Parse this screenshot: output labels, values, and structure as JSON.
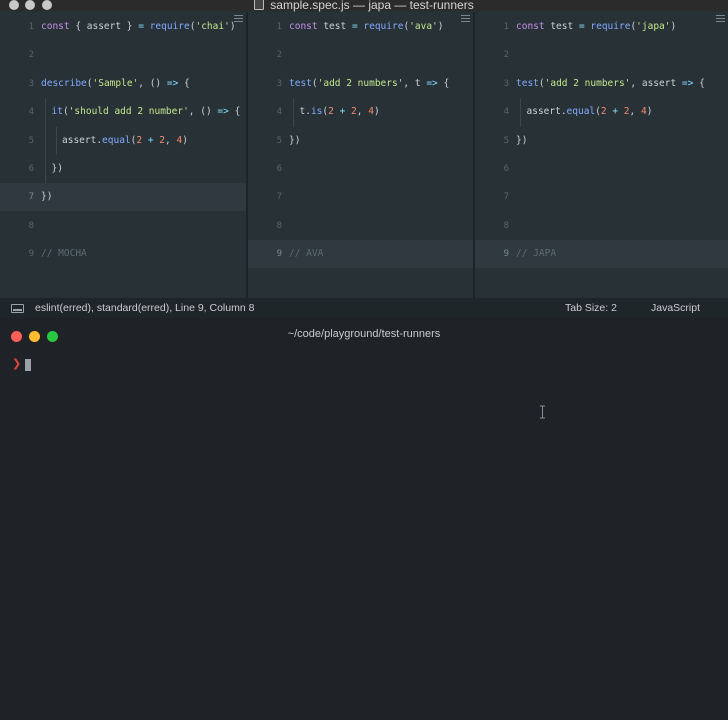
{
  "window": {
    "title": "sample.spec.js — japa — test-runners"
  },
  "panes": [
    {
      "name": "mocha",
      "lines": [
        {
          "n": "1",
          "tokens": [
            [
              "kw",
              "const "
            ],
            [
              "pl",
              "{ assert } "
            ],
            [
              "op",
              "= "
            ],
            [
              "fn",
              "require"
            ],
            [
              "pl",
              "("
            ],
            [
              "str",
              "'chai'"
            ],
            [
              "pl",
              ")"
            ]
          ]
        },
        {
          "n": "2",
          "tokens": []
        },
        {
          "n": "3",
          "tokens": [
            [
              "fn",
              "describe"
            ],
            [
              "pl",
              "("
            ],
            [
              "str",
              "'Sample'"
            ],
            [
              "pl",
              ", () "
            ],
            [
              "op",
              "=> "
            ],
            [
              "pl",
              "{"
            ]
          ]
        },
        {
          "n": "4",
          "indent": 1,
          "tokens": [
            [
              "fn",
              "it"
            ],
            [
              "pl",
              "("
            ],
            [
              "str",
              "'should add 2 number'"
            ],
            [
              "pl",
              ", () "
            ],
            [
              "op",
              "=> "
            ],
            [
              "pl",
              "{"
            ]
          ]
        },
        {
          "n": "5",
          "indent": 2,
          "tokens": [
            [
              "pl",
              "assert."
            ],
            [
              "fn",
              "equal"
            ],
            [
              "pl",
              "("
            ],
            [
              "num",
              "2"
            ],
            [
              "op",
              " + "
            ],
            [
              "num",
              "2"
            ],
            [
              "pl",
              ", "
            ],
            [
              "num",
              "4"
            ],
            [
              "pl",
              ")"
            ]
          ]
        },
        {
          "n": "6",
          "indent": 1,
          "tokens": [
            [
              "pl",
              "})"
            ]
          ]
        },
        {
          "n": "7",
          "active": true,
          "tokens": [
            [
              "pl",
              "})"
            ]
          ]
        },
        {
          "n": "8",
          "tokens": []
        },
        {
          "n": "9",
          "tokens": [
            [
              "cm",
              "// MOCHA"
            ]
          ]
        }
      ]
    },
    {
      "name": "ava",
      "lines": [
        {
          "n": "1",
          "tokens": [
            [
              "kw",
              "const "
            ],
            [
              "pl",
              "test "
            ],
            [
              "op",
              "= "
            ],
            [
              "fn",
              "require"
            ],
            [
              "pl",
              "("
            ],
            [
              "str",
              "'ava'"
            ],
            [
              "pl",
              ")"
            ]
          ]
        },
        {
          "n": "2",
          "tokens": []
        },
        {
          "n": "3",
          "tokens": [
            [
              "fn",
              "test"
            ],
            [
              "pl",
              "("
            ],
            [
              "str",
              "'add 2 numbers'"
            ],
            [
              "pl",
              ", t "
            ],
            [
              "op",
              "=> "
            ],
            [
              "pl",
              "{"
            ]
          ]
        },
        {
          "n": "4",
          "indent": 1,
          "tokens": [
            [
              "pl",
              "t."
            ],
            [
              "fn",
              "is"
            ],
            [
              "pl",
              "("
            ],
            [
              "num",
              "2"
            ],
            [
              "op",
              " + "
            ],
            [
              "num",
              "2"
            ],
            [
              "pl",
              ", "
            ],
            [
              "num",
              "4"
            ],
            [
              "pl",
              ")"
            ]
          ]
        },
        {
          "n": "5",
          "tokens": [
            [
              "pl",
              "})"
            ]
          ]
        },
        {
          "n": "6",
          "tokens": []
        },
        {
          "n": "7",
          "tokens": []
        },
        {
          "n": "8",
          "tokens": []
        },
        {
          "n": "9",
          "active": true,
          "tokens": [
            [
              "cm",
              "// AVA"
            ]
          ]
        }
      ]
    },
    {
      "name": "japa",
      "lines": [
        {
          "n": "1",
          "tokens": [
            [
              "kw",
              "const "
            ],
            [
              "pl",
              "test "
            ],
            [
              "op",
              "= "
            ],
            [
              "fn",
              "require"
            ],
            [
              "pl",
              "("
            ],
            [
              "str",
              "'japa'"
            ],
            [
              "pl",
              ")"
            ]
          ]
        },
        {
          "n": "2",
          "tokens": []
        },
        {
          "n": "3",
          "tokens": [
            [
              "fn",
              "test"
            ],
            [
              "pl",
              "("
            ],
            [
              "str",
              "'add 2 numbers'"
            ],
            [
              "pl",
              ", assert "
            ],
            [
              "op",
              "=> "
            ],
            [
              "pl",
              "{"
            ]
          ]
        },
        {
          "n": "4",
          "indent": 1,
          "tokens": [
            [
              "pl",
              "assert."
            ],
            [
              "fn",
              "equal"
            ],
            [
              "pl",
              "("
            ],
            [
              "num",
              "2"
            ],
            [
              "op",
              " + "
            ],
            [
              "num",
              "2"
            ],
            [
              "pl",
              ", "
            ],
            [
              "num",
              "4"
            ],
            [
              "pl",
              ")"
            ]
          ]
        },
        {
          "n": "5",
          "tokens": [
            [
              "pl",
              "})"
            ]
          ]
        },
        {
          "n": "6",
          "tokens": []
        },
        {
          "n": "7",
          "tokens": []
        },
        {
          "n": "8",
          "tokens": []
        },
        {
          "n": "9",
          "active": true,
          "tokens": [
            [
              "cm",
              "// JAPA"
            ]
          ]
        }
      ]
    }
  ],
  "statusbar": {
    "info": "eslint(erred), standard(erred), Line 9, Column 8",
    "tab_size": "Tab Size: 2",
    "language": "JavaScript"
  },
  "terminal": {
    "title": "~/code/playground/test-runners",
    "prompt": "❯"
  },
  "colors": {
    "editor_bg": "#283136",
    "terminal_bg": "#1f2327",
    "keyword": "#c792ea",
    "function": "#82aaff",
    "string": "#c3e88d",
    "number": "#f78c6c",
    "comment": "#5c6b74",
    "close": "#fe5f57",
    "minimize": "#febc2e",
    "zoom": "#28c840"
  }
}
